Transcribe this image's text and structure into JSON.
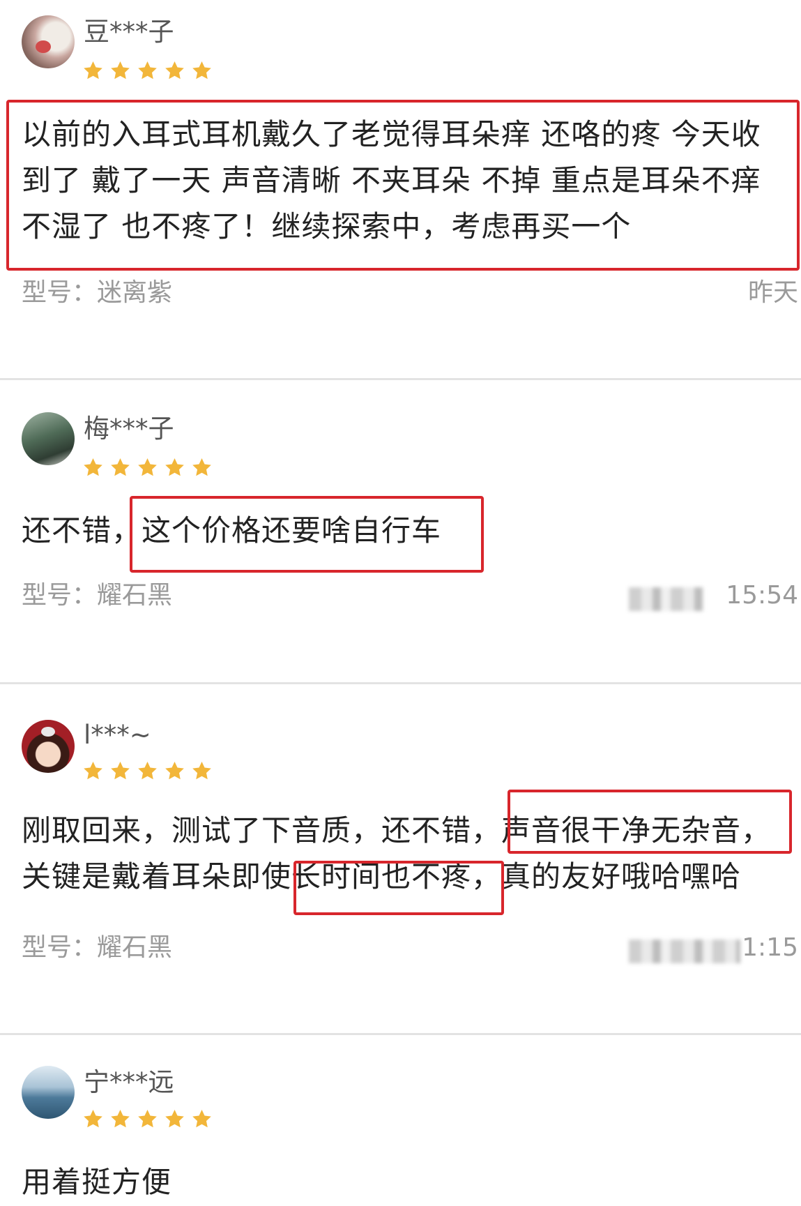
{
  "reviews": [
    {
      "user": "豆***子",
      "rating": 5,
      "text_lines": [
        "以前的入耳式耳机戴久了老觉得耳朵痒 还咯的疼 今天收",
        "到了 戴了一天 声音清晰 不夹耳朵 不掉 重点是耳朵不痒",
        "不湿了 也不疼了！继续探索中，考虑再买一个"
      ],
      "model": "型号：迷离紫",
      "time": "昨天"
    },
    {
      "user": "梅***子",
      "rating": 5,
      "text_lines": [
        "还不错，这个价格还要啥自行车"
      ],
      "model": "型号：耀石黑",
      "time": "15:54"
    },
    {
      "user": "l***~",
      "rating": 5,
      "text_lines": [
        "刚取回来，测试了下音质，还不错，声音很干净无杂音，",
        "关键是戴着耳朵即使长时间也不疼，真的友好哦哈嘿哈"
      ],
      "model": "型号：耀石黑",
      "time": "1:15"
    },
    {
      "user": "宁***远",
      "rating": 5,
      "text_lines": [
        "用着挺方便"
      ]
    }
  ],
  "colors": {
    "star": "#f2b63a",
    "highlight_border": "#d8262c",
    "meta_text": "#9a9a9a"
  },
  "icons": [
    "star-icon",
    "avatar"
  ]
}
